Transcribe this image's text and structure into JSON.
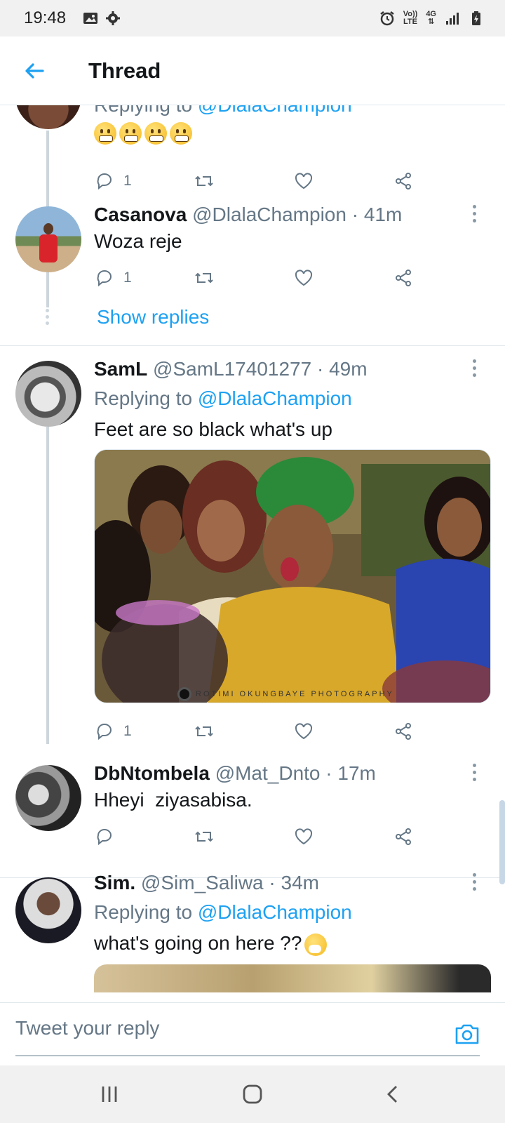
{
  "status_bar": {
    "time": "19:48",
    "net_top": "Vo))",
    "net_bottom": "LTE",
    "gen": "4G"
  },
  "header": {
    "title": "Thread"
  },
  "tweets": [
    {
      "replying_prefix": "Replying to",
      "replying_handle": "@DlalaChampion",
      "emoji_text": "😬😬😬😬",
      "reply_count": "1"
    },
    {
      "name": "Casanova",
      "handle": "@DlalaChampion",
      "sep": "·",
      "time": "41m",
      "text": "Woza reje",
      "reply_count": "1",
      "show_replies": "Show replies"
    },
    {
      "name": "SamL",
      "handle": "@SamL17401277",
      "sep": "·",
      "time": "49m",
      "replying_prefix": "Replying to",
      "replying_handle": "@DlalaChampion",
      "text": "Feet are so black what's up",
      "image_watermark": "ROTIMI OKUNGBAYE PHOTOGRAPHY",
      "reply_count": "1"
    },
    {
      "name": "DbNtombela",
      "handle": "@Mat_Dnto",
      "sep": "·",
      "time": "17m",
      "text": "Hheyi  ziyasabisa.",
      "reply_count": ""
    },
    {
      "name": "Sim.",
      "handle": "@Sim_Saliwa",
      "sep": "·",
      "time": "34m",
      "replying_prefix": "Replying to",
      "replying_handle": "@DlalaChampion",
      "text": "what's going on here ??"
    }
  ],
  "composer": {
    "placeholder": "Tweet your reply"
  },
  "icons": {
    "reply": "reply-icon",
    "retweet": "retweet-icon",
    "like": "like-icon",
    "share": "share-icon",
    "camera": "camera-icon"
  },
  "colors": {
    "accent": "#1da1f2",
    "secondary_text": "#657786",
    "divider": "#e1e8ed"
  }
}
